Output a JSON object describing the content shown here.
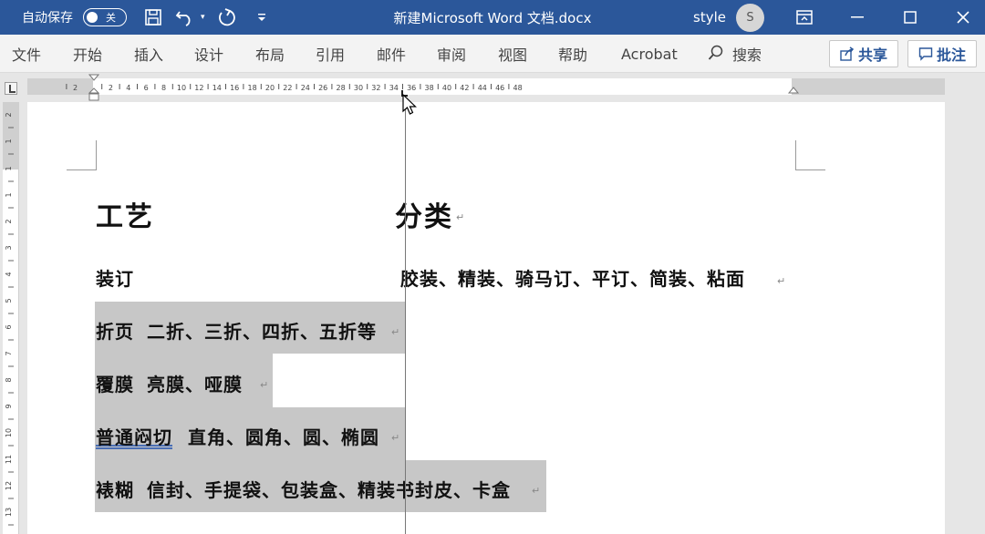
{
  "titlebar": {
    "autosave_label": "自动保存",
    "autosave_state": "关",
    "doc_title": "新建Microsoft Word 文档.docx",
    "user_name": "style",
    "avatar_initial": "S",
    "bg_color": "#2b579a"
  },
  "menu": {
    "items": [
      "文件",
      "开始",
      "插入",
      "设计",
      "布局",
      "引用",
      "邮件",
      "审阅",
      "视图",
      "帮助",
      "Acrobat"
    ],
    "tell_me": "搜索",
    "share_label": "共享",
    "comment_label": "批注"
  },
  "ruler": {
    "labels": [
      "2",
      "2",
      "4",
      "6",
      "8",
      "10",
      "12",
      "14",
      "16",
      "18",
      "20",
      "22",
      "24",
      "26",
      "28",
      "30",
      "32",
      "34",
      "36",
      "38",
      "40",
      "42",
      "44",
      "46",
      "48"
    ],
    "vlabels": [
      "2",
      "1",
      "1",
      "1",
      "2",
      "3",
      "4",
      "5",
      "6",
      "7",
      "8",
      "9",
      "10",
      "11",
      "12",
      "13"
    ]
  },
  "document": {
    "heading_left": "工艺",
    "heading_right": "分类",
    "rows": [
      {
        "label": "装订",
        "value": "胶装、精装、骑马订、平订、简装、粘面"
      },
      {
        "label": "折页",
        "value": "二折、三折、四折、五折等"
      },
      {
        "label": "覆膜",
        "value": "亮膜、哑膜"
      },
      {
        "label": "普通闷切",
        "value": "直角、圆角、圆、椭圆"
      },
      {
        "label": "裱糊",
        "value": "信封、手提袋、包装盒、精装书封皮、卡盒"
      }
    ],
    "para_mark": "↵",
    "highlight_color": "#c7c7c7"
  }
}
